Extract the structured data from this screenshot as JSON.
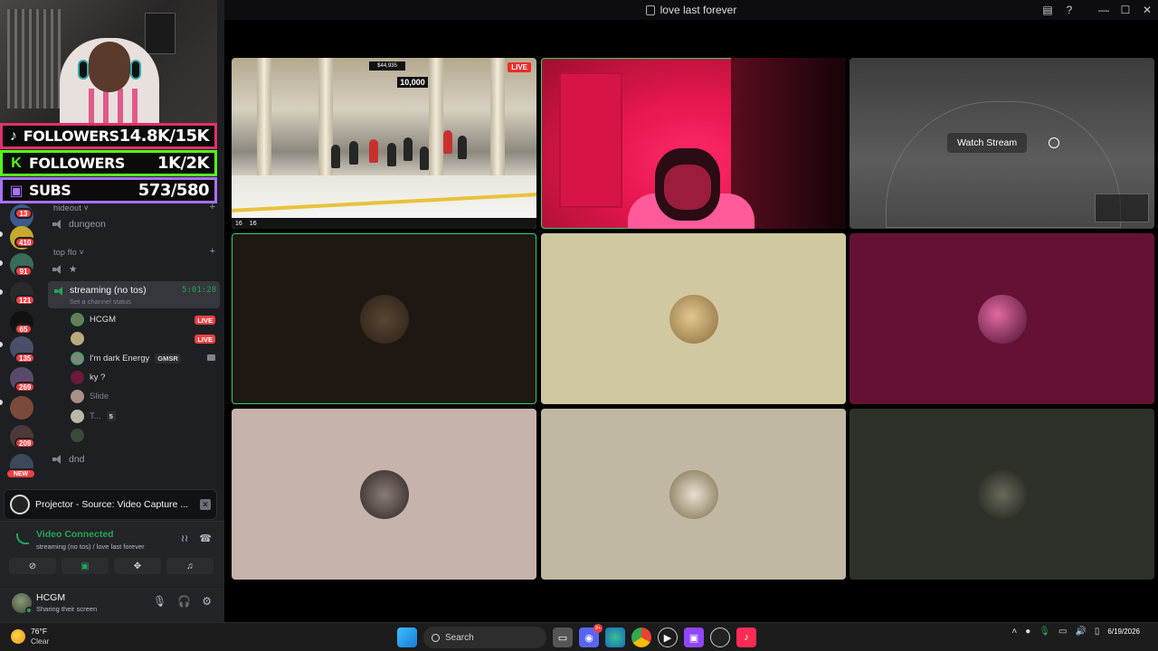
{
  "window": {
    "title": "love last forever"
  },
  "overlay": {
    "rows": [
      {
        "platform": "tiktok",
        "label": "FOLLOWERS",
        "value": "14.8K/15K",
        "border_color": "#e0306a",
        "icon": "♪"
      },
      {
        "platform": "kick",
        "label": "FOLLOWERS",
        "value": "1K/2K",
        "border_color": "#53fc18",
        "icon": "K"
      },
      {
        "platform": "twitch",
        "label": "SUBS",
        "value": "573/580",
        "border_color": "#a970ff",
        "icon": "▣"
      }
    ]
  },
  "servers": {
    "badges": [
      "13",
      "410",
      "91",
      "121",
      "65",
      "135",
      "269",
      "209"
    ],
    "new_label": "NEW"
  },
  "channels": {
    "cat_hideout": "hideout",
    "ch_dungeon": "dungeon",
    "cat_topflo": "top flo",
    "ch_star": "★",
    "streaming": {
      "name": "streaming (no tos)",
      "timer": "5:01:28",
      "status": "Set a channel status"
    },
    "members": [
      {
        "name": "HCGM",
        "live": "LIVE"
      },
      {
        "name": "",
        "live": "LIVE"
      },
      {
        "name": "I'm dark Energy",
        "tag": "GMSR"
      },
      {
        "name": "ky ?"
      },
      {
        "name": "Slide"
      },
      {
        "name": "T...",
        "tag": "5"
      },
      {
        "name": ""
      }
    ],
    "ch_dnd": "dnd"
  },
  "projector": {
    "title": "Projector - Source: Video Capture ..."
  },
  "voice": {
    "status": "Video Connected",
    "location": "streaming (no tos) / love last forever"
  },
  "user": {
    "name": "HCGM",
    "status": "Sharing their screen"
  },
  "tiles": {
    "game": {
      "live": "LIVE",
      "score": "10,000",
      "coins": "$44,935",
      "home_score": "16",
      "away_score": "16"
    },
    "watch_stream": "Watch Stream"
  },
  "taskbar": {
    "weather_temp": "76°F",
    "weather_desc": "Clear",
    "search_placeholder": "Search",
    "clock_date": "6/19/2026"
  },
  "colors": {
    "accent_green": "#23a559",
    "live_red": "#ed4245",
    "speaking_outline": "#2dd36f"
  }
}
